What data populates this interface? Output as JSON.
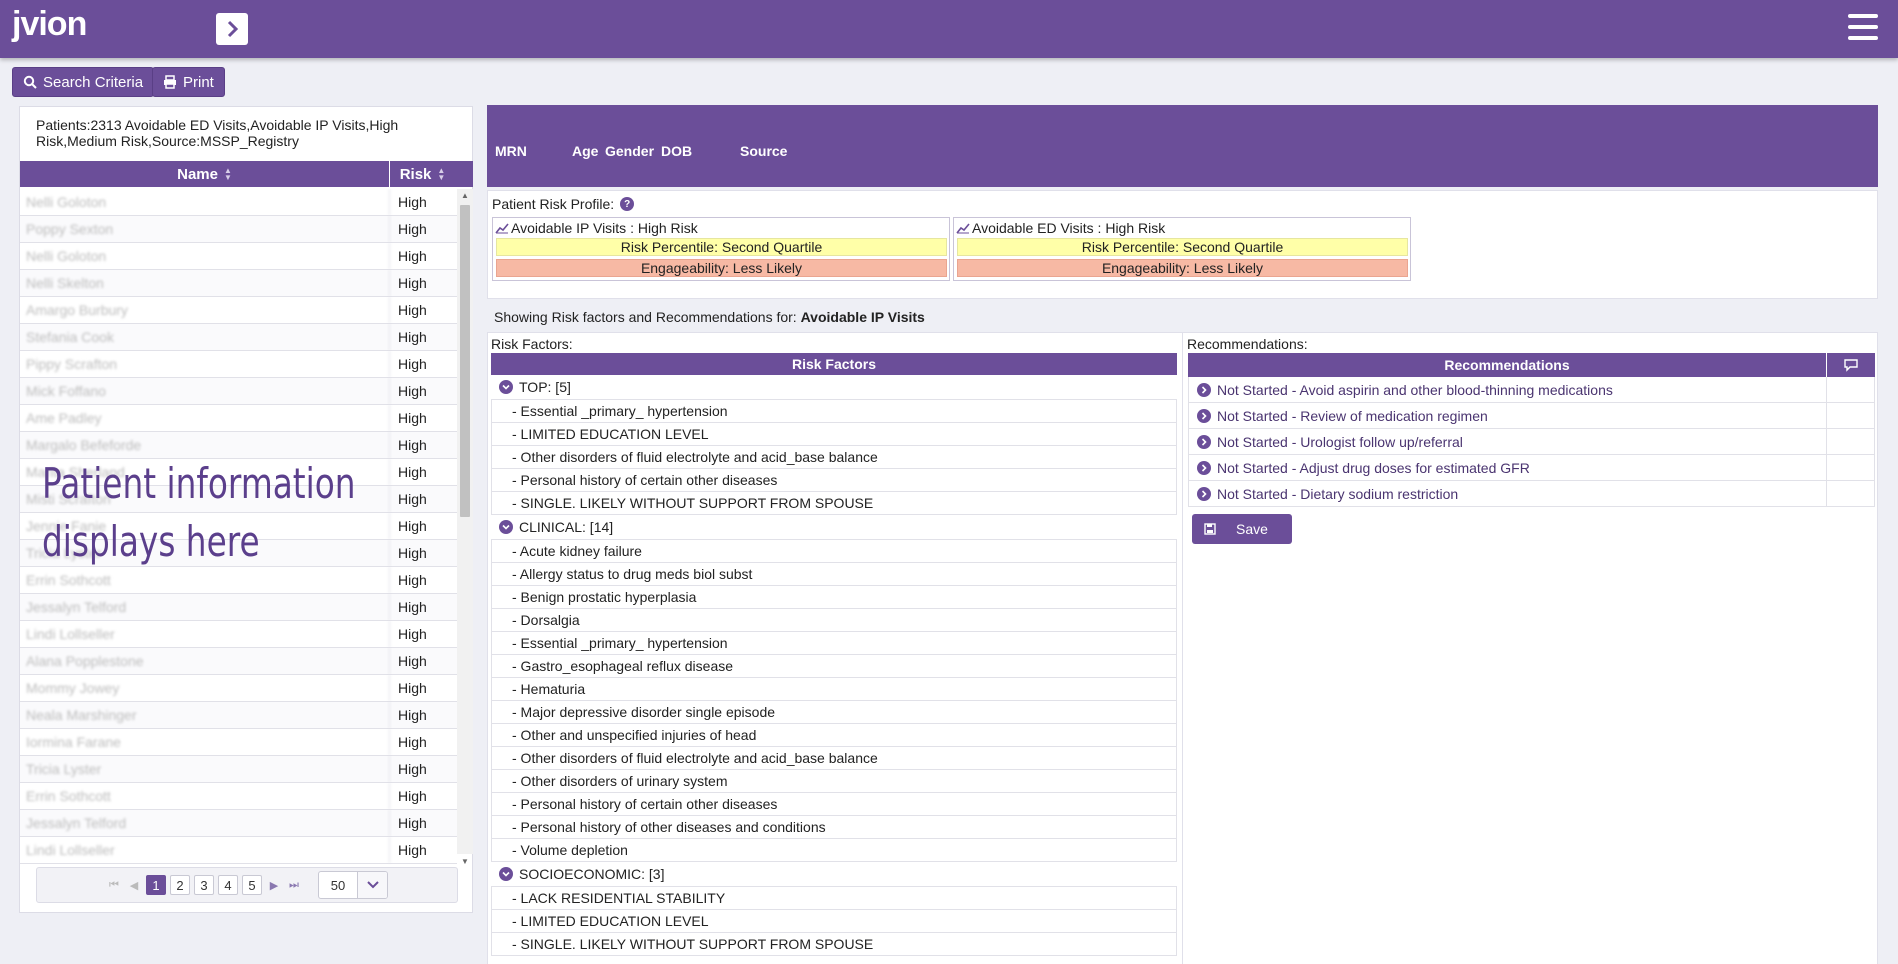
{
  "app": {
    "logo": "jvion"
  },
  "toolbar": {
    "search_label": "Search Criteria",
    "print_label": "Print"
  },
  "patients": {
    "summary": "Patients:2313 Avoidable ED Visits,Avoidable IP Visits,High Risk,Medium Risk,Source:MSSP_Registry",
    "columns": {
      "name": "Name",
      "risk": "Risk"
    },
    "rows": [
      {
        "name": "Nelli Goloton",
        "risk": "High"
      },
      {
        "name": "Poppy Sexton",
        "risk": "High"
      },
      {
        "name": "Nelli Goloton",
        "risk": "High"
      },
      {
        "name": "Nelli Skelton",
        "risk": "High"
      },
      {
        "name": "Amargo Burbury",
        "risk": "High"
      },
      {
        "name": "Stefania Cook",
        "risk": "High"
      },
      {
        "name": "Pippy Scrafton",
        "risk": "High"
      },
      {
        "name": "Mick Foffano",
        "risk": "High"
      },
      {
        "name": "Ame Padley",
        "risk": "High"
      },
      {
        "name": "Margalo Befeforde",
        "risk": "High"
      },
      {
        "name": "Marita Sherland",
        "risk": "High"
      },
      {
        "name": "Misti Scrafton",
        "risk": "High"
      },
      {
        "name": "Jennie Fanie",
        "risk": "High"
      },
      {
        "name": "Tricia Lyster",
        "risk": "High"
      },
      {
        "name": "Errin Sothcott",
        "risk": "High"
      },
      {
        "name": "Jessalyn Telford",
        "risk": "High"
      },
      {
        "name": "Lindi Lollseller",
        "risk": "High"
      },
      {
        "name": "Alana Popplestone",
        "risk": "High"
      },
      {
        "name": "Mommy Jowey",
        "risk": "High"
      },
      {
        "name": "Neala Marshinger",
        "risk": "High"
      },
      {
        "name": "Iormina Farane",
        "risk": "High"
      },
      {
        "name": "Tricia Lyster",
        "risk": "High"
      },
      {
        "name": "Errin Sothcott",
        "risk": "High"
      },
      {
        "name": "Jessalyn Telford",
        "risk": "High"
      },
      {
        "name": "Lindi Lollseller",
        "risk": "High"
      }
    ],
    "overlay": [
      "Patient information",
      "displays here"
    ],
    "pager": {
      "pages": [
        "1",
        "2",
        "3",
        "4",
        "5"
      ],
      "active": "1",
      "page_size": "50"
    }
  },
  "patient_header": {
    "mrn": "MRN",
    "age": "Age",
    "gender": "Gender",
    "dob": "DOB",
    "source": "Source"
  },
  "risk_profile": {
    "label": "Patient Risk Profile:",
    "cards": [
      {
        "title": "Avoidable IP Visits : High Risk",
        "percentile": "Risk Percentile: Second Quartile",
        "engage": "Engageability: Less Likely"
      },
      {
        "title": "Avoidable ED Visits : High Risk",
        "percentile": "Risk Percentile: Second Quartile",
        "engage": "Engageability: Less Likely"
      }
    ]
  },
  "showing": {
    "prefix": "Showing Risk factors and Recommendations for: ",
    "target": "Avoidable IP Visits"
  },
  "risk_factors": {
    "label": "Risk Factors:",
    "header": "Risk Factors",
    "groups": [
      {
        "title": "TOP: [5]",
        "items": [
          "- Essential _primary_ hypertension",
          "- LIMITED EDUCATION LEVEL",
          "- Other disorders of fluid electrolyte and acid_base balance",
          "- Personal history of certain other diseases",
          "- SINGLE. LIKELY WITHOUT SUPPORT FROM SPOUSE"
        ]
      },
      {
        "title": "CLINICAL: [14]",
        "items": [
          "- Acute kidney failure",
          "- Allergy status to drug meds biol subst",
          "- Benign prostatic hyperplasia",
          "- Dorsalgia",
          "- Essential _primary_ hypertension",
          "- Gastro_esophageal reflux disease",
          "- Hematuria",
          "- Major depressive disorder single episode",
          "- Other and unspecified injuries of head",
          "- Other disorders of fluid electrolyte and acid_base balance",
          "- Other disorders of urinary system",
          "- Personal history of certain other diseases",
          "- Personal history of other diseases and conditions",
          "- Volume depletion"
        ]
      },
      {
        "title": "SOCIOECONOMIC: [3]",
        "items": [
          "- LACK RESIDENTIAL STABILITY",
          "- LIMITED EDUCATION LEVEL",
          "- SINGLE. LIKELY WITHOUT SUPPORT FROM SPOUSE"
        ]
      }
    ]
  },
  "recommendations": {
    "label": "Recommendations:",
    "header": "Recommendations",
    "rows": [
      "Not Started - Avoid aspirin and other blood-thinning medications",
      "Not Started - Review of medication regimen",
      "Not Started - Urologist follow up/referral",
      "Not Started - Adjust drug doses for estimated GFR",
      "Not Started - Dietary sodium restriction"
    ],
    "save_label": "Save"
  },
  "colors": {
    "brand": "#6b4e99",
    "percentile_bg": "#ffffa8",
    "engage_bg": "#f7b9a4"
  }
}
